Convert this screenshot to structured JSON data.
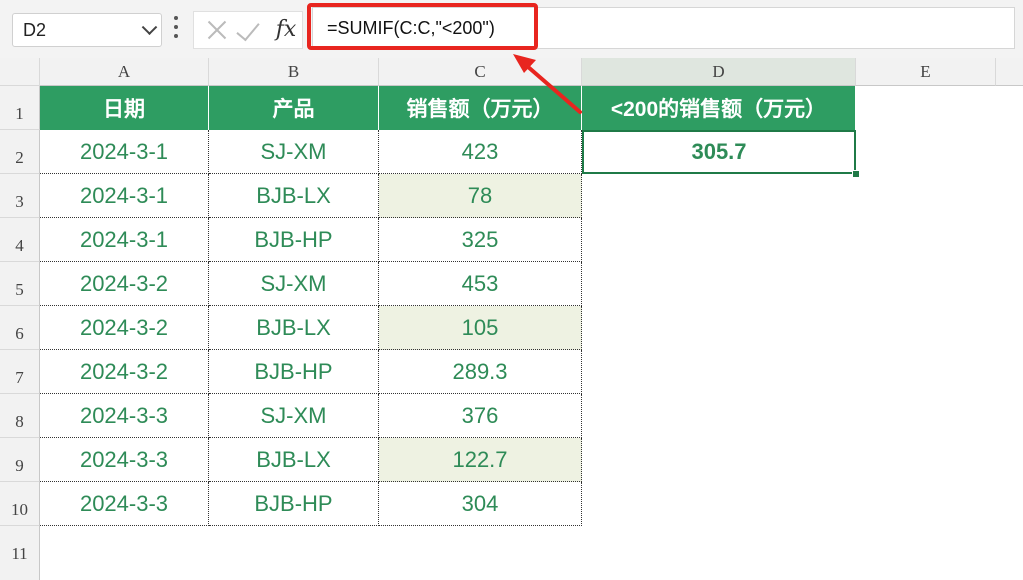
{
  "formula_bar": {
    "cell_ref": "D2",
    "formula": "=SUMIF(C:C,\"<200\")",
    "fx_label": "fx"
  },
  "columns": [
    "A",
    "B",
    "C",
    "D",
    "E"
  ],
  "rows": [
    "1",
    "2",
    "3",
    "4",
    "5",
    "6",
    "7",
    "8",
    "9",
    "10",
    "11"
  ],
  "table": {
    "headers": [
      "日期",
      "产品",
      "销售额（万元）"
    ],
    "rows": [
      {
        "date": "2024-3-1",
        "product": "SJ-XM",
        "sales": "423"
      },
      {
        "date": "2024-3-1",
        "product": "BJB-LX",
        "sales": "78"
      },
      {
        "date": "2024-3-1",
        "product": "BJB-HP",
        "sales": "325"
      },
      {
        "date": "2024-3-2",
        "product": "SJ-XM",
        "sales": "453"
      },
      {
        "date": "2024-3-2",
        "product": "BJB-LX",
        "sales": "105"
      },
      {
        "date": "2024-3-2",
        "product": "BJB-HP",
        "sales": "289.3"
      },
      {
        "date": "2024-3-3",
        "product": "SJ-XM",
        "sales": "376"
      },
      {
        "date": "2024-3-3",
        "product": "BJB-LX",
        "sales": "122.7"
      },
      {
        "date": "2024-3-3",
        "product": "BJB-HP",
        "sales": "304"
      }
    ]
  },
  "result": {
    "header": "<200的销售额（万元）",
    "value": "305.7"
  },
  "colors": {
    "header_bg": "#2e9d62",
    "text_green": "#2e8b57",
    "highlight_bg": "#eef2e2",
    "annotation_red": "#e8251f"
  }
}
